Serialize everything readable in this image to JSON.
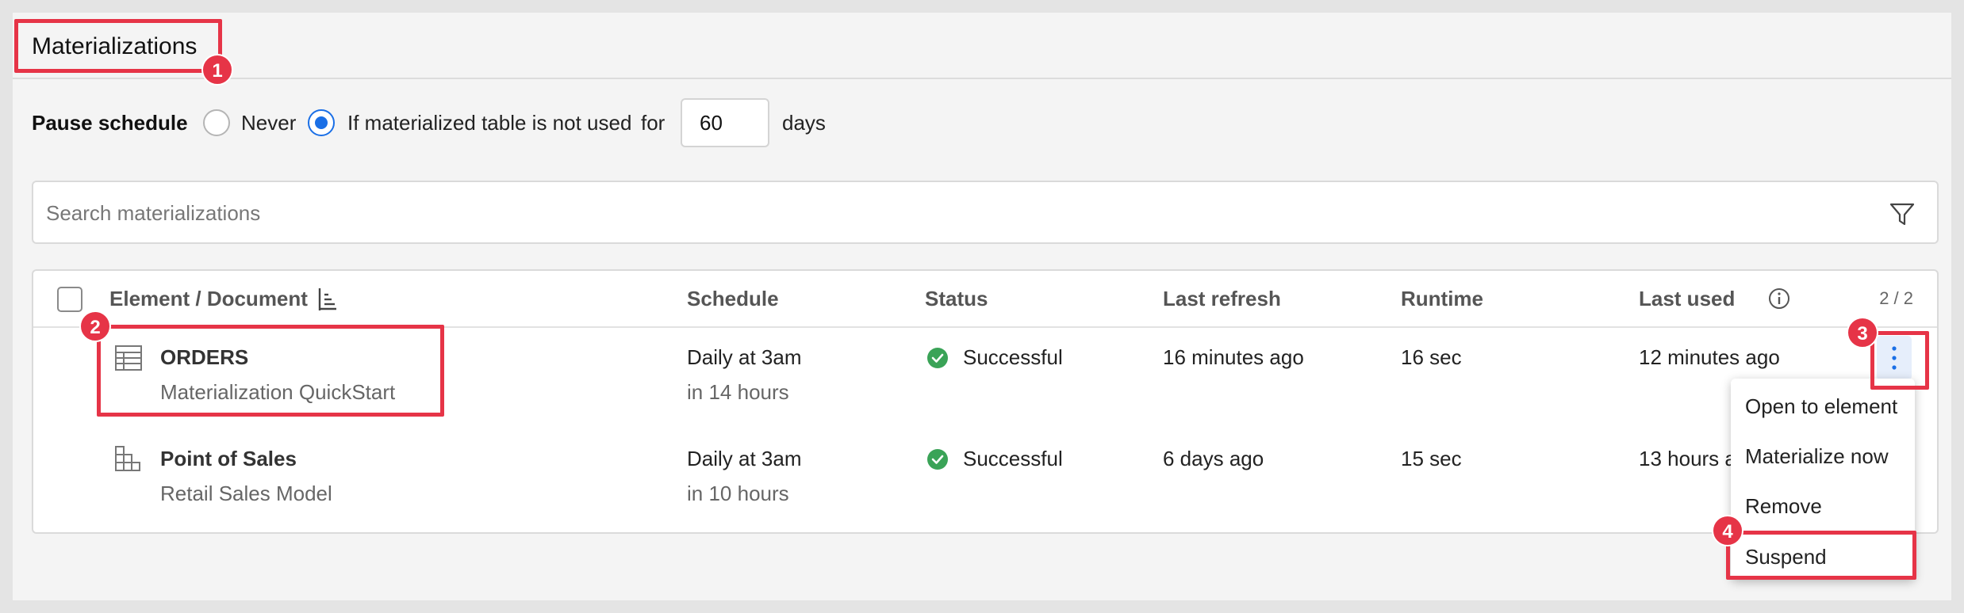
{
  "section": {
    "title": "Materializations"
  },
  "pause": {
    "label": "Pause schedule",
    "option_never": "Never",
    "option_unused": "If materialized table is not used",
    "for_label": "for",
    "days_value": "60",
    "days_unit": "days",
    "selected": "unused"
  },
  "search": {
    "placeholder": "Search materializations"
  },
  "table": {
    "headers": {
      "element": "Element / Document",
      "schedule": "Schedule",
      "status": "Status",
      "last_refresh": "Last refresh",
      "runtime": "Runtime",
      "last_used": "Last used"
    },
    "count": "2 / 2",
    "rows": [
      {
        "name": "ORDERS",
        "document": "Materialization QuickStart",
        "schedule": "Daily at 3am",
        "next_run": "in 14 hours",
        "status": "Successful",
        "last_refresh": "16 minutes ago",
        "runtime": "16 sec",
        "last_used": "12 minutes ago",
        "icon": "table-icon"
      },
      {
        "name": "Point of Sales",
        "document": "Retail Sales Model",
        "schedule": "Daily at 3am",
        "next_run": "in 10 hours",
        "status": "Successful",
        "last_refresh": "6 days ago",
        "runtime": "15 sec",
        "last_used": "13 hours a",
        "icon": "pivot-table-icon"
      }
    ]
  },
  "row_menu": {
    "items": [
      "Open to element",
      "Materialize now",
      "Remove",
      "Suspend"
    ]
  },
  "annotations": [
    "1",
    "2",
    "3",
    "4"
  ],
  "colors": {
    "accent": "#1a6fe6",
    "success": "#3aa357",
    "highlight": "#e63447"
  }
}
